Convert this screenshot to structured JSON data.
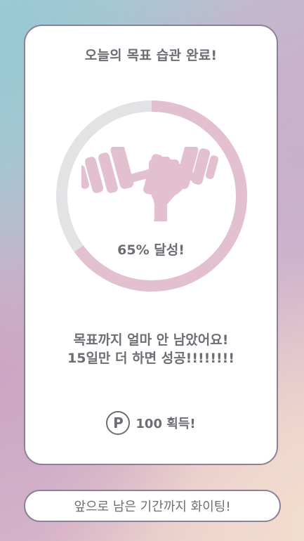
{
  "card": {
    "title": "오늘의 목표 습관 완료!",
    "progress": {
      "percent": 65,
      "label": "65% 달성!"
    },
    "message": {
      "line1": "목표까지 얼마 안 남았어요!",
      "line2": "15일만 더 하면 성공!!!!!!!!"
    },
    "reward": {
      "icon_letter": "P",
      "text": "100  획득!"
    }
  },
  "footer": {
    "text": "앞으로 남은 기간까지 화이팅!"
  },
  "icons": {
    "habit": "dumbbell-fist-icon",
    "reward": "point-icon"
  },
  "colors": {
    "accent": "#e2c0cf",
    "track": "#e3e2e5",
    "text": "#706c75",
    "border": "#8c8197"
  }
}
